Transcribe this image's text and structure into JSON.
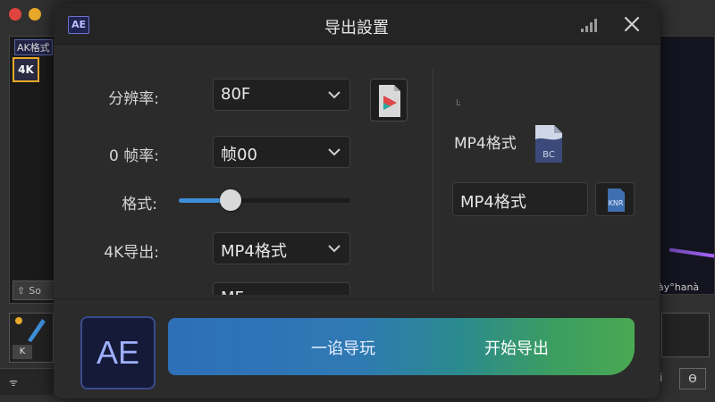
{
  "background_app": {
    "left_tag": "AK格式",
    "resolution_badge": "4K",
    "so_button": "So",
    "k_key": "K",
    "bottom_left_text": "ᯤ",
    "right_text": "ày°hanà",
    "right_icon_glyph": "ϴ",
    "right_i": "i"
  },
  "dialog": {
    "logo": "AE",
    "title": "导出設置",
    "rows": [
      {
        "label": "分辨率:",
        "value": "80F"
      },
      {
        "label": "0 帧率:",
        "value": "帧00"
      },
      {
        "label": "格式:",
        "slider_fraction": 0.3
      },
      {
        "label": "4K导出:",
        "value": "MP4格式"
      },
      {
        "label": "",
        "value": "MF"
      }
    ],
    "right": {
      "small_mark": "Ŀ",
      "format_label": "MP4格式",
      "doc_icon_text": "BC",
      "format_field": "MP4格式",
      "field_button_text": "KNR"
    },
    "footer": {
      "logo": "AE",
      "secondary_label": "一谄导玩",
      "primary_label": "开始导出"
    }
  },
  "colors": {
    "accent_blue": "#3f8fd8",
    "gradient_start": "#2e6fb8",
    "gradient_end": "#4aa852"
  }
}
